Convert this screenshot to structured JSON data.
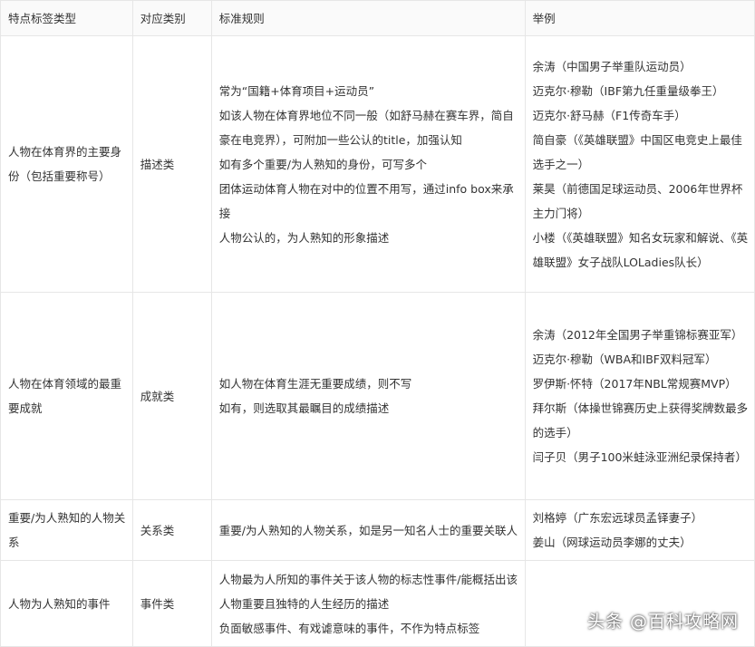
{
  "headers": [
    "特点标签类型",
    "对应类别",
    "标准规则",
    "举例"
  ],
  "rows": [
    {
      "type": "人物在体育界的主要身份（包括重要称号）",
      "category": "描述类",
      "rules": [
        "常为“国籍+体育项目+运动员”",
        "如该人物在体育界地位不同一般（如舒马赫在赛车界，简自豪在电竞界），可附加一些公认的title，加强认知",
        "如有多个重要/为人熟知的身份，可写多个",
        "团体运动体育人物在对中的位置不用写，通过info box来承接",
        "人物公认的，为人熟知的形象描述"
      ],
      "examples": [
        "余涛（中国男子举重队运动员）",
        "迈克尔·穆勒（IBF第九任重量级拳王）",
        "迈克尔·舒马赫（F1传奇车手）",
        "简自豪（《英雄联盟》中国区电竞史上最佳选手之一）",
        "莱昊（前德国足球运动员、2006年世界杯主力门将）",
        "小楼（《英雄联盟》知名女玩家和解说、《英雄联盟》女子战队LOLadies队长）"
      ]
    },
    {
      "type": "人物在体育领域的最重要成就",
      "category": "成就类",
      "rules": [
        "如人物在体育生涯无重要成绩，则不写",
        "如有，则选取其最瞩目的成绩描述"
      ],
      "examples": [
        "余涛（2012年全国男子举重锦标赛亚军）",
        "迈克尔·穆勒（WBA和IBF双料冠军）",
        "罗伊斯·怀特（2017年NBL常规赛MVP）",
        "拜尔斯（体操世锦赛历史上获得奖牌数最多的选手）",
        "闫子贝（男子100米蛙泳亚洲纪录保持者）"
      ]
    },
    {
      "type": "重要/为人熟知的人物关系",
      "category": "关系类",
      "rules": [
        "重要/为人熟知的人物关系，如是另一知名人士的重要关联人"
      ],
      "examples": [
        "刘格婷（广东宏远球员孟铎妻子）",
        "姜山（网球运动员李娜的丈夫）"
      ]
    },
    {
      "type": "人物为人熟知的事件",
      "category": "事件类",
      "rules": [
        "人物最为人所知的事件关于该人物的标志性事件/能概括出该人物重要且独特的人生经历的描述",
        "负面敏感事件、有戏谑意味的事件，不作为特点标签"
      ],
      "examples": []
    }
  ],
  "watermark": "头条 @百科攻略网"
}
